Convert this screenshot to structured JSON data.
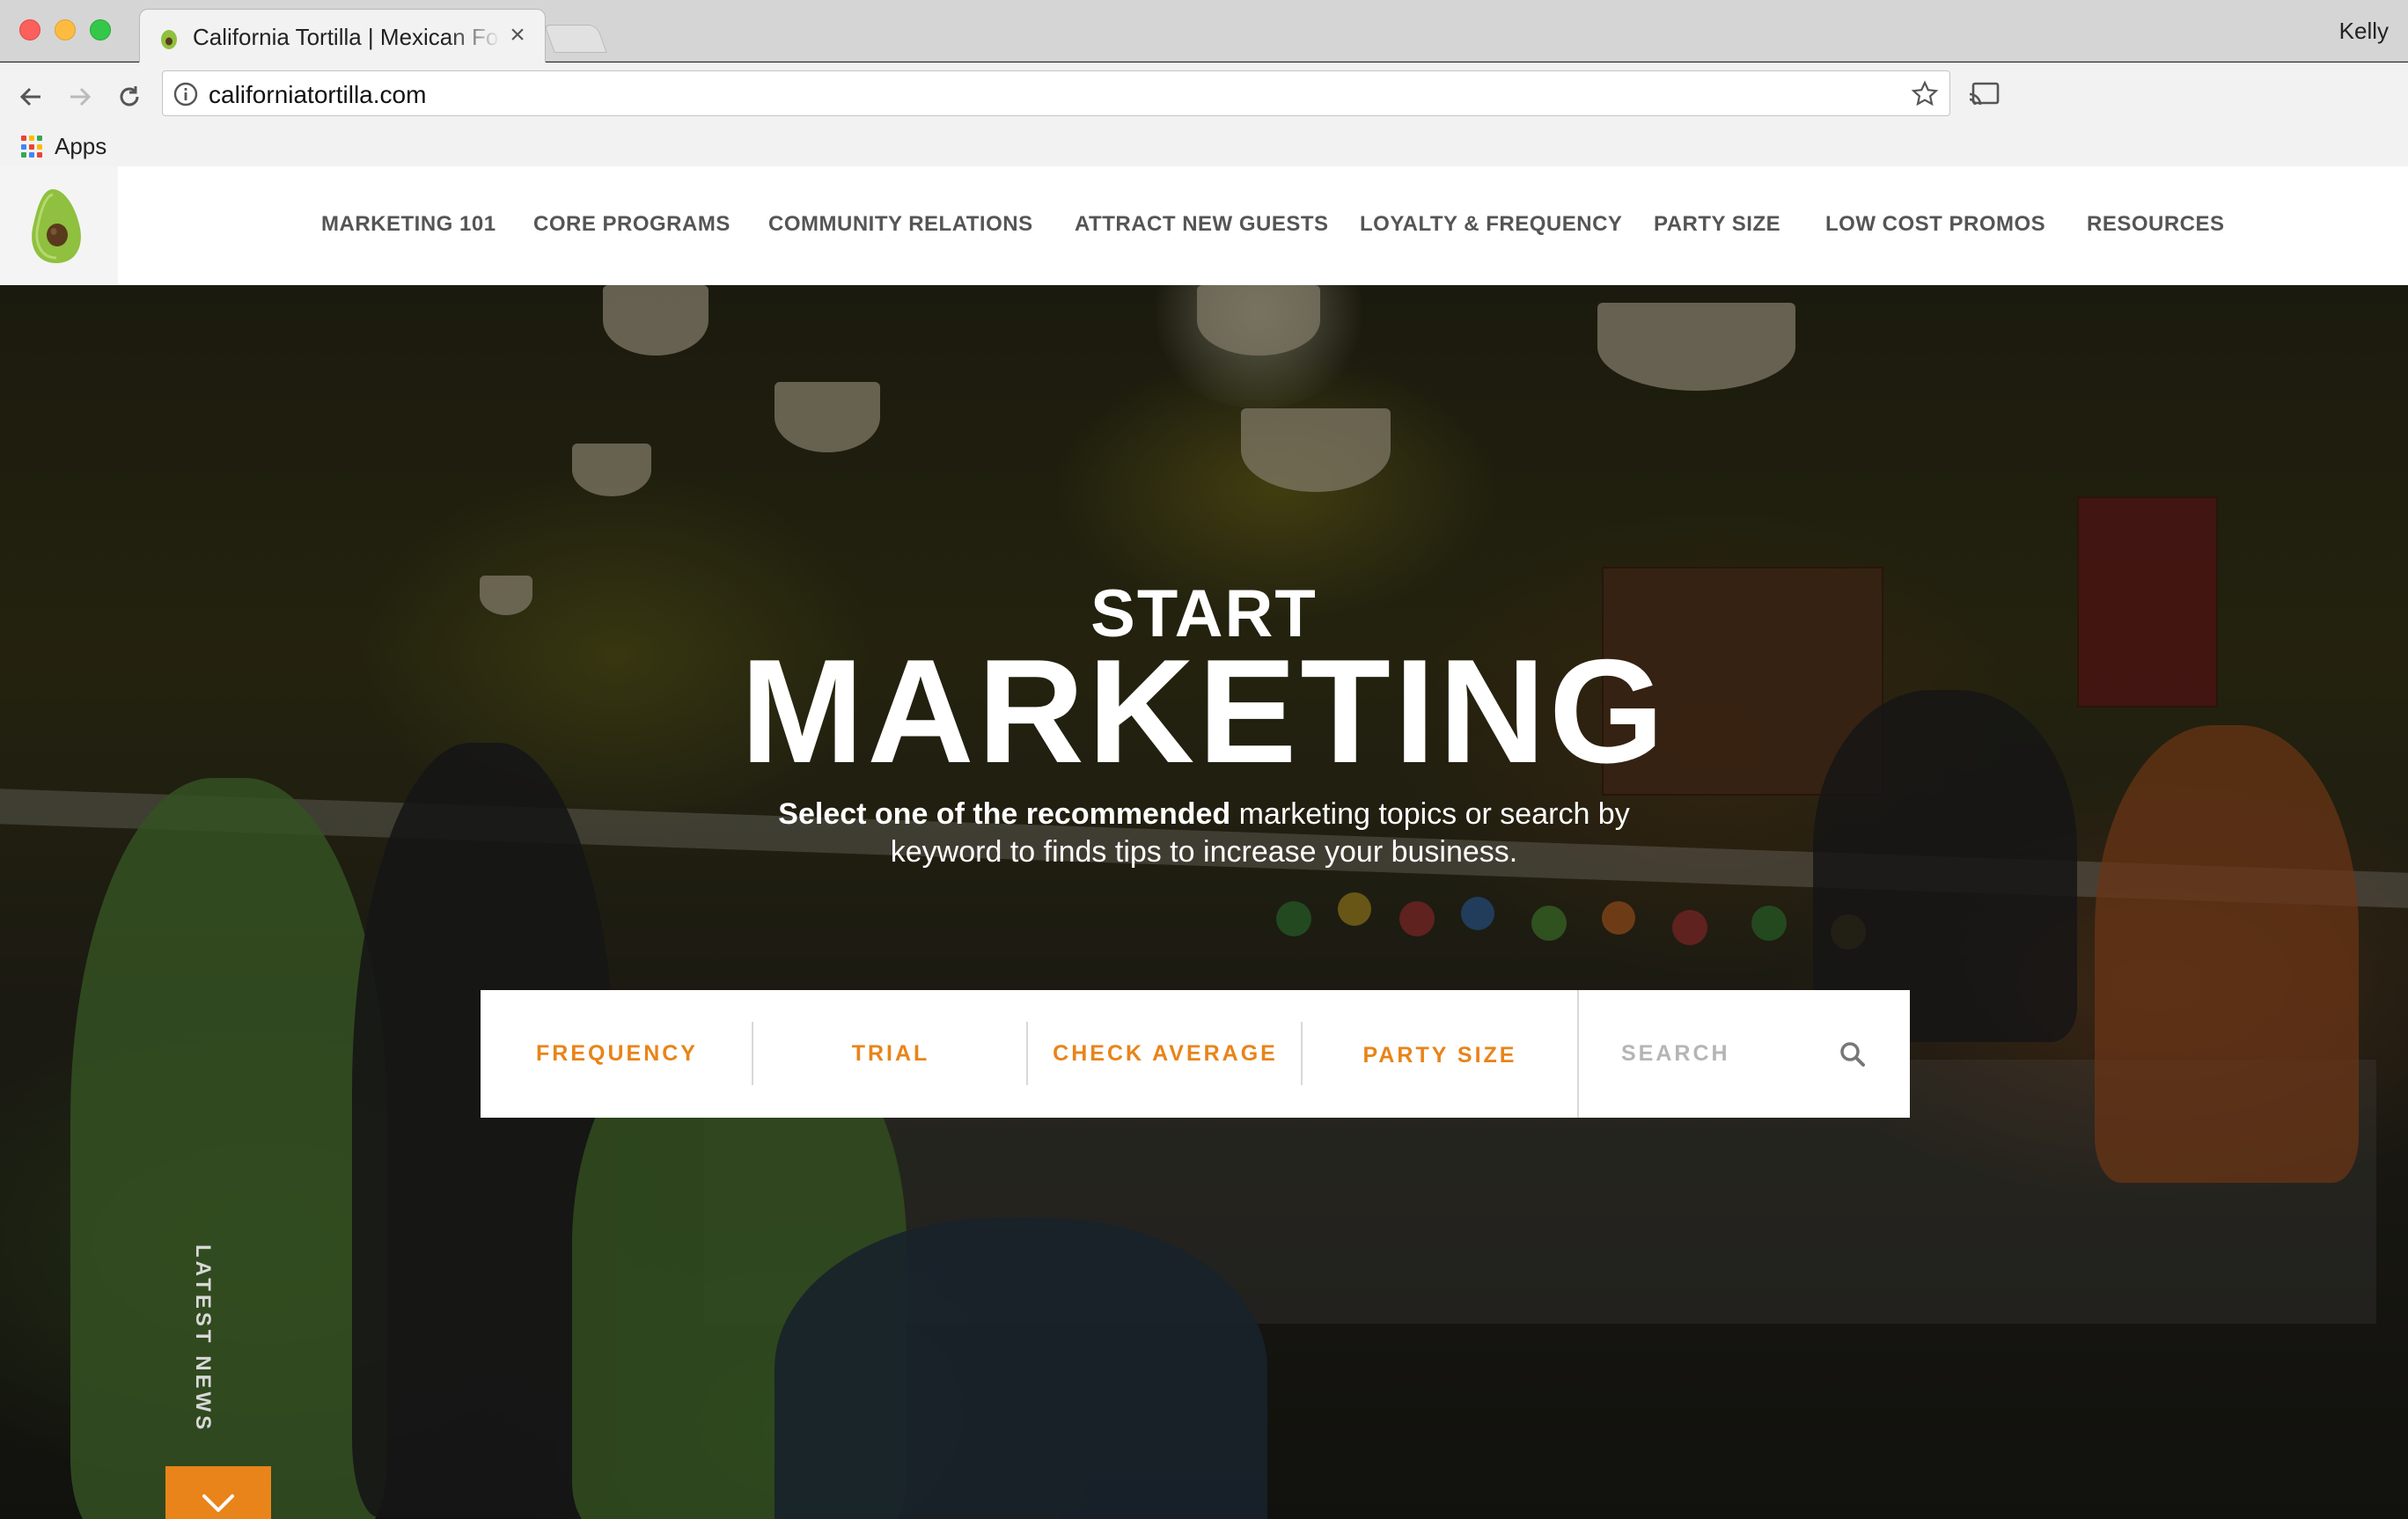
{
  "browser": {
    "tab_title": "California Tortilla | Mexican Fo",
    "tab_close": "×",
    "profile_name": "Kelly",
    "url": "californiatortilla.com",
    "bookmarks": {
      "apps_label": "Apps"
    }
  },
  "site": {
    "logo_icon": "avocado-icon",
    "nav": [
      {
        "label": "MARKETING 101"
      },
      {
        "label": "CORE PROGRAMS"
      },
      {
        "label": "COMMUNITY RELATIONS"
      },
      {
        "label": "ATTRACT NEW GUESTS"
      },
      {
        "label": "LOYALTY & FREQUENCY"
      },
      {
        "label": "PARTY SIZE"
      },
      {
        "label": "LOW COST PROMOS"
      },
      {
        "label": "RESOURCES"
      }
    ]
  },
  "hero": {
    "kicker": "START",
    "title": "MARKETING",
    "subtitle_bold": "Select one of the recommended",
    "subtitle_rest": " marketing topics or search by keyword to finds tips to increase your business.",
    "topics": [
      {
        "label": "FREQUENCY"
      },
      {
        "label": "TRIAL"
      },
      {
        "label": "CHECK AVERAGE"
      },
      {
        "label": "PARTY SIZE"
      }
    ],
    "search_placeholder": "SEARCH",
    "latest_news": "LATEST NEWS"
  },
  "colors": {
    "accent": "#e8841a",
    "nav_text": "#555555",
    "avocado_green": "#8fc03f"
  }
}
